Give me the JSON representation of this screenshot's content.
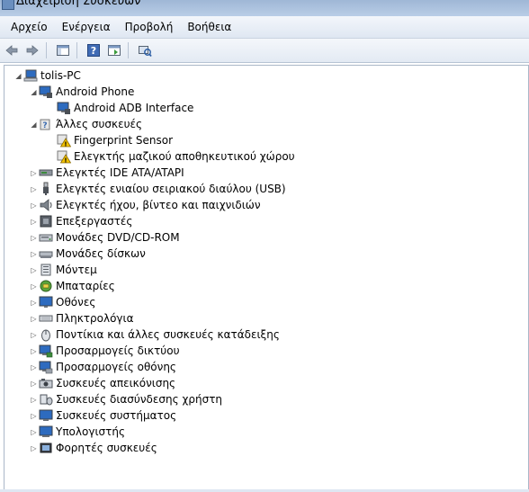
{
  "window": {
    "title": "Διαχείριση Συσκευών"
  },
  "menu": [
    "Αρχείο",
    "Ενέργεια",
    "Προβολή",
    "Βοήθεια"
  ],
  "toolbar": {
    "buttons": [
      {
        "icon": "back-arrow-icon"
      },
      {
        "icon": "forward-arrow-icon"
      },
      {
        "icon": "console-tree-icon"
      },
      {
        "icon": "help-icon"
      },
      {
        "icon": "properties-icon"
      },
      {
        "icon": "scan-hardware-icon"
      }
    ]
  },
  "tree": {
    "root": {
      "label": "tolis-PC",
      "expanded": true,
      "icon": "computer-icon"
    },
    "nodes": [
      {
        "label": "Android Phone",
        "level": 1,
        "expanded": true,
        "icon": "monitor-device-icon"
      },
      {
        "label": "Android ADB Interface",
        "level": 2,
        "icon": "monitor-device-icon"
      },
      {
        "label": "Άλλες συσκευές",
        "level": 1,
        "expanded": true,
        "icon": "unknown-device-icon"
      },
      {
        "label": "Fingerprint Sensor",
        "level": 2,
        "icon": "warning-device-icon"
      },
      {
        "label": "Ελεγκτής μαζικού αποθηκευτικού χώρου",
        "level": 2,
        "icon": "warning-device-icon"
      },
      {
        "label": "Ελεγκτές IDE ATA/ATAPI",
        "level": 1,
        "expanded": false,
        "icon": "ide-controller-icon"
      },
      {
        "label": "Ελεγκτές ενιαίου σειριακού διαύλου (USB)",
        "level": 1,
        "expanded": false,
        "icon": "usb-icon"
      },
      {
        "label": "Ελεγκτές ήχου, βίντεο και παιχνιδιών",
        "level": 1,
        "expanded": false,
        "icon": "speaker-icon"
      },
      {
        "label": "Επεξεργαστές",
        "level": 1,
        "expanded": false,
        "icon": "processor-icon"
      },
      {
        "label": "Μονάδες DVD/CD-ROM",
        "level": 1,
        "expanded": false,
        "icon": "dvd-drive-icon"
      },
      {
        "label": "Μονάδες δίσκων",
        "level": 1,
        "expanded": false,
        "icon": "disk-drive-icon"
      },
      {
        "label": "Μόντεμ",
        "level": 1,
        "expanded": false,
        "icon": "modem-icon"
      },
      {
        "label": "Μπαταρίες",
        "level": 1,
        "expanded": false,
        "icon": "battery-icon"
      },
      {
        "label": "Οθόνες",
        "level": 1,
        "expanded": false,
        "icon": "monitor-icon"
      },
      {
        "label": "Πληκτρολόγια",
        "level": 1,
        "expanded": false,
        "icon": "keyboard-icon"
      },
      {
        "label": "Ποντίκια και άλλες συσκευές κατάδειξης",
        "level": 1,
        "expanded": false,
        "icon": "mouse-icon"
      },
      {
        "label": "Προσαρμογείς δικτύου",
        "level": 1,
        "expanded": false,
        "icon": "network-adapter-icon"
      },
      {
        "label": "Προσαρμογείς οθόνης",
        "level": 1,
        "expanded": false,
        "icon": "display-adapter-icon"
      },
      {
        "label": "Συσκευές απεικόνισης",
        "level": 1,
        "expanded": false,
        "icon": "imaging-device-icon"
      },
      {
        "label": "Συσκευές διασύνδεσης χρήστη",
        "level": 1,
        "expanded": false,
        "icon": "hid-icon"
      },
      {
        "label": "Συσκευές συστήματος",
        "level": 1,
        "expanded": false,
        "icon": "system-device-icon"
      },
      {
        "label": "Υπολογιστής",
        "level": 1,
        "expanded": false,
        "icon": "computer-icon"
      },
      {
        "label": "Φορητές συσκευές",
        "level": 1,
        "expanded": false,
        "icon": "portable-device-icon"
      }
    ]
  },
  "colors": {
    "warning": "#f2c200",
    "monitor_screen": "#2d6bbf",
    "menubar": "#e6edf6"
  }
}
